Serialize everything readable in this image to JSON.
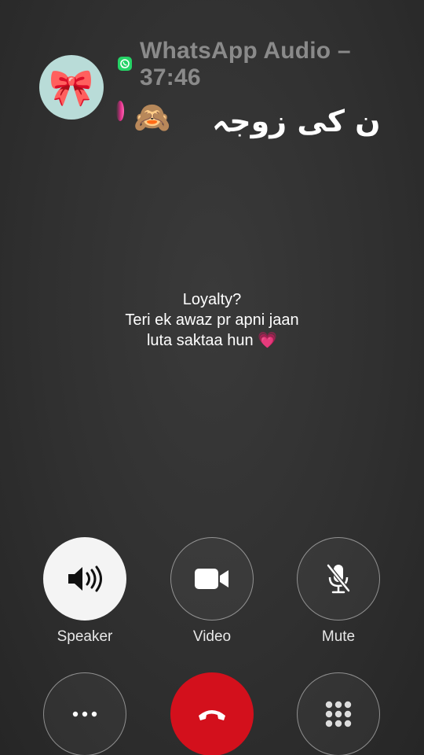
{
  "caller": {
    "avatar_emoji": "🎀",
    "app_icon": "whatsapp-icon",
    "title_line1": "WhatsApp Audio –",
    "title_line2": "37:46",
    "status_emoji": "🙈",
    "name": "ن کی زوجہ"
  },
  "caption": {
    "line1": "Loyalty?",
    "line2": "Teri ek awaz pr apni jaan",
    "line3": "luta saktaa hun 💗"
  },
  "controls": {
    "speaker_label": "Speaker",
    "video_label": "Video",
    "mute_label": "Mute"
  },
  "colors": {
    "accent_end_call": "#d3101c",
    "avatar_bg": "#b9dcd8",
    "whatsapp_green": "#25d366"
  }
}
